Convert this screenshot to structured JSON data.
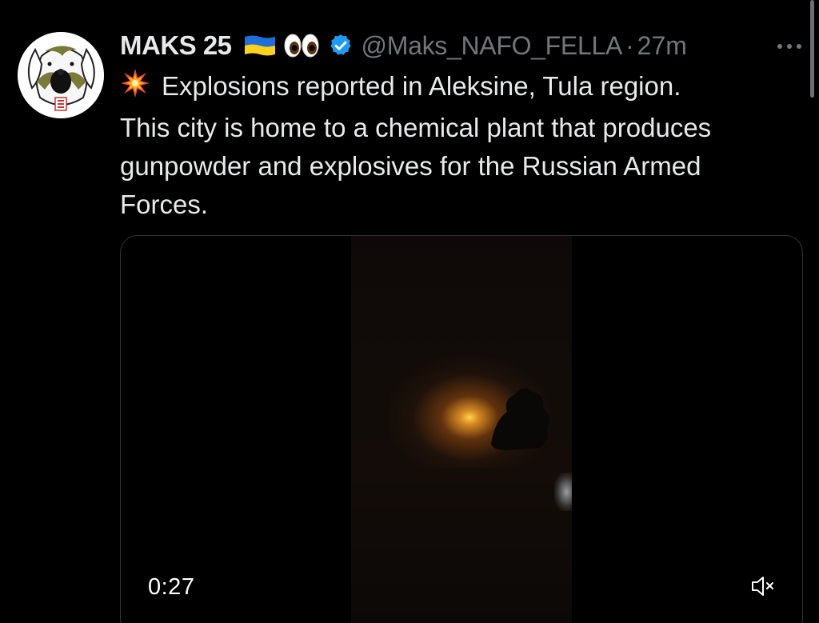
{
  "post": {
    "display_name": "MAKS 25",
    "name_badges": [
      "ukraine-flag-icon",
      "eyes-icon"
    ],
    "verified": true,
    "handle": "@Maks_NAFO_FELLA",
    "separator": "·",
    "timestamp": "27m",
    "more_icon": "more-horizontal-icon",
    "text_lines": [
      "Explosions reported in Aleksine, Tula region.",
      "This city is home to a chemical plant that produces",
      "gunpowder and explosives for the Russian Armed",
      "Forces."
    ],
    "leading_emoji": "collision-icon"
  },
  "media": {
    "duration": "0:27",
    "muted": true,
    "mute_icon": "speaker-muted-icon"
  },
  "colors": {
    "background": "#000000",
    "text_primary": "#e7e9ea",
    "text_secondary": "#71767b",
    "verified_blue": "#1d9bf0",
    "media_border": "#2f3336"
  }
}
